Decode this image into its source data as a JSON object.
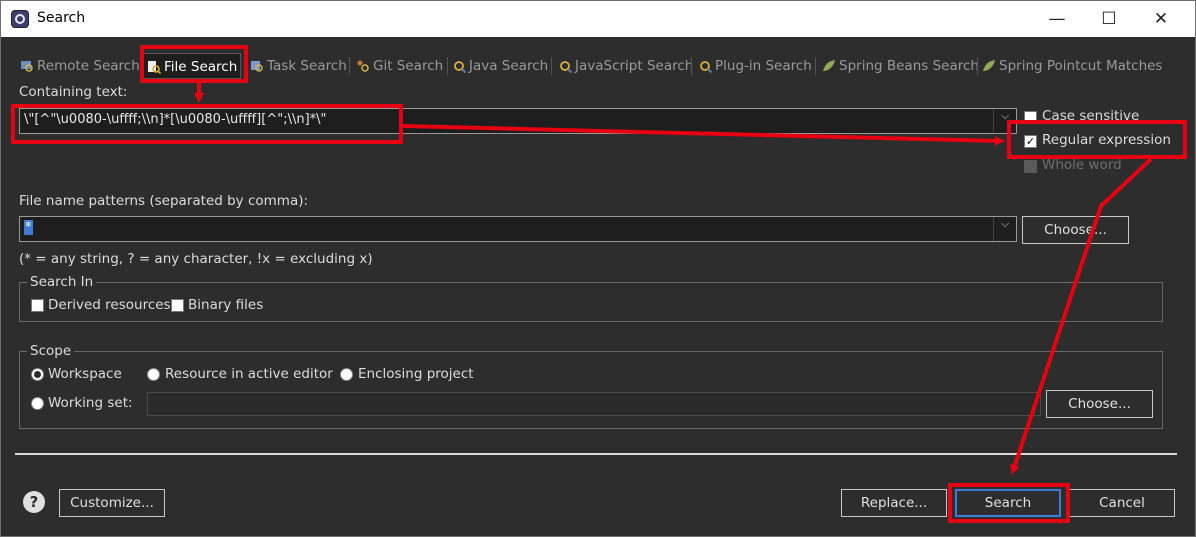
{
  "window": {
    "title": "Search",
    "minimize_glyph": "—",
    "maximize_glyph": "☐",
    "close_glyph": "✕"
  },
  "tabs": [
    {
      "label": "Remote Search",
      "icon": "remote-search-icon",
      "active": false
    },
    {
      "label": "File Search",
      "icon": "file-search-icon",
      "active": true
    },
    {
      "label": "Task Search",
      "icon": "task-search-icon",
      "active": false
    },
    {
      "label": "Git Search",
      "icon": "git-search-icon",
      "active": false
    },
    {
      "label": "Java Search",
      "icon": "java-search-icon",
      "active": false
    },
    {
      "label": "JavaScript Search",
      "icon": "javascript-search-icon",
      "active": false
    },
    {
      "label": "Plug-in Search",
      "icon": "plugin-search-icon",
      "active": false
    },
    {
      "label": "Spring Beans Search",
      "icon": "spring-beans-search-icon",
      "active": false
    },
    {
      "label": "Spring Pointcut Matches",
      "icon": "spring-pointcut-icon",
      "active": false
    }
  ],
  "containing_text": {
    "label": "Containing text:",
    "value": "\\\"[^\"\\u0080-\\uffff;\\\\n]*[\\u0080-\\uffff][^\";\\\\n]*\\\""
  },
  "options": {
    "case_sensitive": {
      "label": "Case sensitive",
      "checked": false
    },
    "regular_expression": {
      "label": "Regular expression",
      "checked": true
    },
    "whole_word": {
      "label": "Whole word",
      "checked": false,
      "disabled": true
    }
  },
  "file_patterns": {
    "label": "File name patterns (separated by comma):",
    "value": "*",
    "hint": "(* = any string, ? = any character, !x = excluding x)",
    "choose_label": "Choose..."
  },
  "search_in": {
    "title": "Search In",
    "derived": "Derived resources",
    "binary": "Binary files"
  },
  "scope": {
    "title": "Scope",
    "workspace": "Workspace",
    "resource_active": "Resource in active editor",
    "enclosing": "Enclosing project",
    "working_set": "Working set:",
    "choose_label": "Choose..."
  },
  "footer": {
    "customize": "Customize...",
    "replace": "Replace...",
    "search": "Search",
    "cancel": "Cancel",
    "help_glyph": "?"
  },
  "colors": {
    "annotation": "#e60012",
    "default_button_focus": "#3d7bd6",
    "dialog_bg": "#2d2d2d"
  }
}
